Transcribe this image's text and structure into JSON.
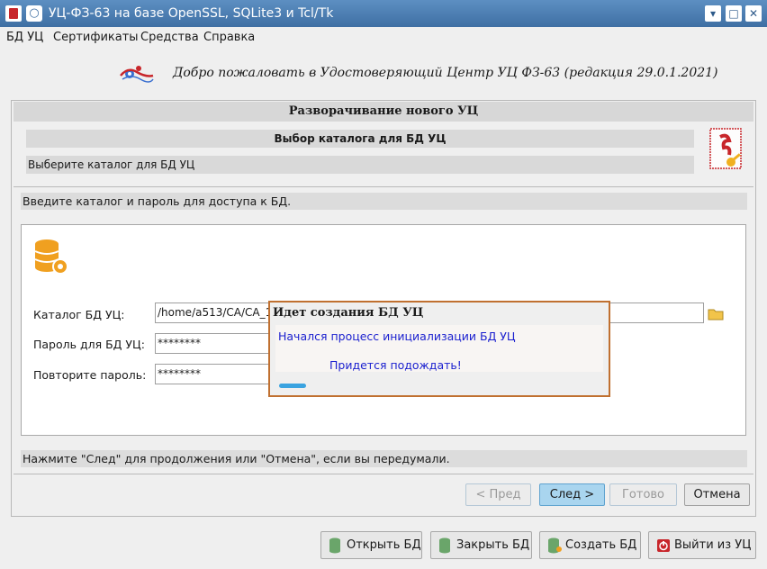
{
  "window": {
    "title": "УЦ-ФЗ-63 на базе OpenSSL, SQLite3 и Tcl/Tk",
    "minimize": "▾",
    "maximize": "□",
    "close": "✕"
  },
  "menu": [
    "БД УЦ",
    "Сертификаты",
    "Средства",
    "Справка"
  ],
  "welcome": "Добро пожаловать в Удостоверяющий Центр УЦ ФЗ-63 (редакция 29.0.1.2021)",
  "wizard": {
    "header": "Разворачивание нового УЦ",
    "step_title": "Выбор каталога для БД УЦ",
    "step_desc": "Выберите каталог для БД УЦ",
    "hint": "Введите каталог и пароль для доступа к БД.",
    "fields": {
      "catalog_label": "Каталог БД УЦ:",
      "catalog_value": "/home/a513/CA/CA_1",
      "password_label": "Пароль для БД УЦ:",
      "password_value": "********",
      "repeat_label": "Повторите пароль:",
      "repeat_value": "********"
    },
    "bottom_hint": "Нажмите \"След\" для продолжения или \"Отмена\", если вы передумали.",
    "buttons": {
      "prev": "< Пред",
      "next": "След >",
      "done": "Готово",
      "cancel": "Отмена"
    }
  },
  "dialog": {
    "title": "Идет создания БД УЦ",
    "message": "Начался процесс инициализации БД УЦ",
    "wait": "Придется подождать!",
    "progress": 0.08
  },
  "bottom_buttons": {
    "open_db": "Открыть БД",
    "close_db": "Закрыть БД",
    "create_db": "Создать БД",
    "exit": "Выйти из УЦ"
  },
  "colors": {
    "titlebar": "#4a7db3",
    "dialog_border": "#c07030",
    "dialog_text": "#1a1fcf",
    "primary_button": "#a9d5ef"
  }
}
